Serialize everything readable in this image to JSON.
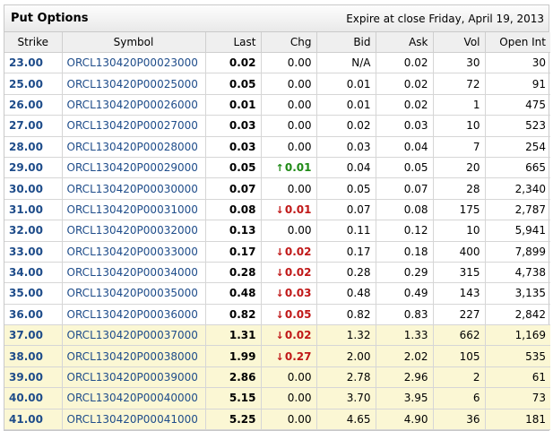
{
  "panel": {
    "title": "Put Options",
    "expire": "Expire at close Friday, April 19, 2013"
  },
  "columns": [
    "Strike",
    "Symbol",
    "Last",
    "Chg",
    "Bid",
    "Ask",
    "Vol",
    "Open Int"
  ],
  "colors": {
    "up": "#1f8a16",
    "down": "#c01818",
    "link": "#1e4c8a",
    "in_the_money": "#fbf7d4"
  },
  "rows": [
    {
      "strike": "23.00",
      "symbol": "ORCL130420P00023000",
      "last": "0.02",
      "chg": "0.00",
      "dir": "none",
      "bid": "N/A",
      "ask": "0.02",
      "vol": "30",
      "oi": "30",
      "itm": false
    },
    {
      "strike": "25.00",
      "symbol": "ORCL130420P00025000",
      "last": "0.05",
      "chg": "0.00",
      "dir": "none",
      "bid": "0.01",
      "ask": "0.02",
      "vol": "72",
      "oi": "91",
      "itm": false
    },
    {
      "strike": "26.00",
      "symbol": "ORCL130420P00026000",
      "last": "0.01",
      "chg": "0.00",
      "dir": "none",
      "bid": "0.01",
      "ask": "0.02",
      "vol": "1",
      "oi": "475",
      "itm": false
    },
    {
      "strike": "27.00",
      "symbol": "ORCL130420P00027000",
      "last": "0.03",
      "chg": "0.00",
      "dir": "none",
      "bid": "0.02",
      "ask": "0.03",
      "vol": "10",
      "oi": "523",
      "itm": false
    },
    {
      "strike": "28.00",
      "symbol": "ORCL130420P00028000",
      "last": "0.03",
      "chg": "0.00",
      "dir": "none",
      "bid": "0.03",
      "ask": "0.04",
      "vol": "7",
      "oi": "254",
      "itm": false
    },
    {
      "strike": "29.00",
      "symbol": "ORCL130420P00029000",
      "last": "0.05",
      "chg": "0.01",
      "dir": "up",
      "bid": "0.04",
      "ask": "0.05",
      "vol": "20",
      "oi": "665",
      "itm": false
    },
    {
      "strike": "30.00",
      "symbol": "ORCL130420P00030000",
      "last": "0.07",
      "chg": "0.00",
      "dir": "none",
      "bid": "0.05",
      "ask": "0.07",
      "vol": "28",
      "oi": "2,340",
      "itm": false
    },
    {
      "strike": "31.00",
      "symbol": "ORCL130420P00031000",
      "last": "0.08",
      "chg": "0.01",
      "dir": "down",
      "bid": "0.07",
      "ask": "0.08",
      "vol": "175",
      "oi": "2,787",
      "itm": false
    },
    {
      "strike": "32.00",
      "symbol": "ORCL130420P00032000",
      "last": "0.13",
      "chg": "0.00",
      "dir": "none",
      "bid": "0.11",
      "ask": "0.12",
      "vol": "10",
      "oi": "5,941",
      "itm": false
    },
    {
      "strike": "33.00",
      "symbol": "ORCL130420P00033000",
      "last": "0.17",
      "chg": "0.02",
      "dir": "down",
      "bid": "0.17",
      "ask": "0.18",
      "vol": "400",
      "oi": "7,899",
      "itm": false
    },
    {
      "strike": "34.00",
      "symbol": "ORCL130420P00034000",
      "last": "0.28",
      "chg": "0.02",
      "dir": "down",
      "bid": "0.28",
      "ask": "0.29",
      "vol": "315",
      "oi": "4,738",
      "itm": false
    },
    {
      "strike": "35.00",
      "symbol": "ORCL130420P00035000",
      "last": "0.48",
      "chg": "0.03",
      "dir": "down",
      "bid": "0.48",
      "ask": "0.49",
      "vol": "143",
      "oi": "3,135",
      "itm": false
    },
    {
      "strike": "36.00",
      "symbol": "ORCL130420P00036000",
      "last": "0.82",
      "chg": "0.05",
      "dir": "down",
      "bid": "0.82",
      "ask": "0.83",
      "vol": "227",
      "oi": "2,842",
      "itm": false
    },
    {
      "strike": "37.00",
      "symbol": "ORCL130420P00037000",
      "last": "1.31",
      "chg": "0.02",
      "dir": "down",
      "bid": "1.32",
      "ask": "1.33",
      "vol": "662",
      "oi": "1,169",
      "itm": true
    },
    {
      "strike": "38.00",
      "symbol": "ORCL130420P00038000",
      "last": "1.99",
      "chg": "0.27",
      "dir": "down",
      "bid": "2.00",
      "ask": "2.02",
      "vol": "105",
      "oi": "535",
      "itm": true
    },
    {
      "strike": "39.00",
      "symbol": "ORCL130420P00039000",
      "last": "2.86",
      "chg": "0.00",
      "dir": "none",
      "bid": "2.78",
      "ask": "2.96",
      "vol": "2",
      "oi": "61",
      "itm": true
    },
    {
      "strike": "40.00",
      "symbol": "ORCL130420P00040000",
      "last": "5.15",
      "chg": "0.00",
      "dir": "none",
      "bid": "3.70",
      "ask": "3.95",
      "vol": "6",
      "oi": "73",
      "itm": true
    },
    {
      "strike": "41.00",
      "symbol": "ORCL130420P00041000",
      "last": "5.25",
      "chg": "0.00",
      "dir": "none",
      "bid": "4.65",
      "ask": "4.90",
      "vol": "36",
      "oi": "181",
      "itm": true
    }
  ]
}
